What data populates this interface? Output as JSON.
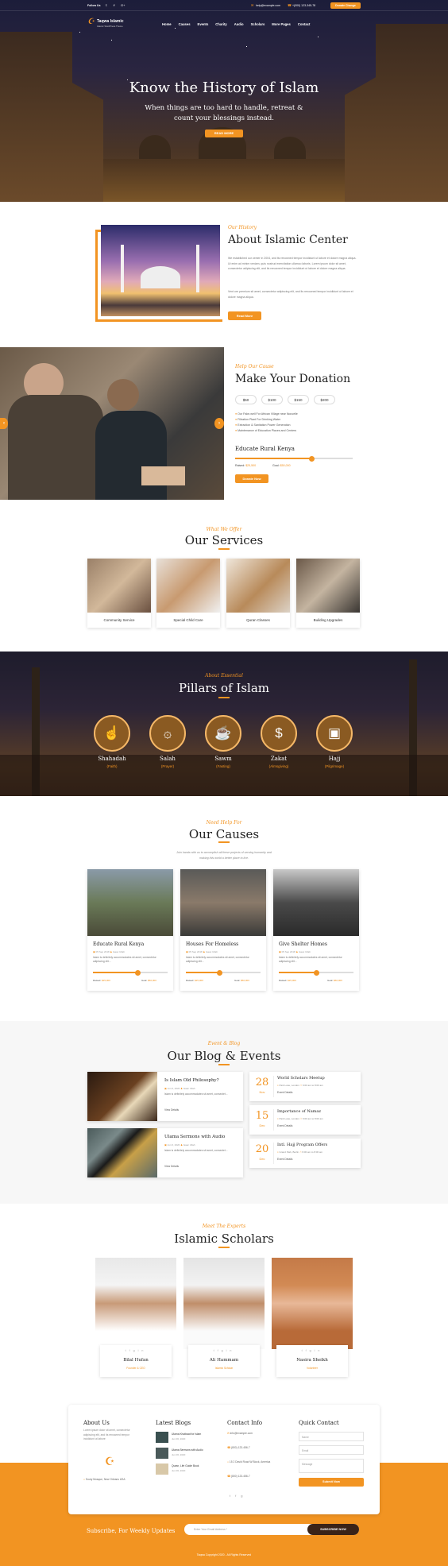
{
  "topbar": {
    "follow": "Follow Us",
    "email": "help@example.com",
    "phone": "+(000) 123-345-78",
    "donate": "Donate Change"
  },
  "logo": {
    "name": "Taqwa Islamic",
    "tagline": "Islamic WordPress Theme"
  },
  "nav": [
    "Home",
    "Causes",
    "Events",
    "Charity",
    "Audio",
    "Scholars",
    "More Pages",
    "Contact"
  ],
  "hero": {
    "title": "Know the History of Islam",
    "subtitle1": "When things are too hard to handle, retreat &",
    "subtitle2": "count your blessings instead.",
    "button": "READ MORE"
  },
  "about": {
    "kicker": "Our History",
    "title": "About Islamic Center",
    "p1": "We established our center in 2004, and its renowned tempor incididunt ut labore et dolore magna aliqua. Ut enim ad minim veniam, quis nostrud exercitation ullamco laboris. Lorem ipsum dolor sit amet, consectetur adipiscing elit, and its renowned tempor incididunt ut labore et dolore magna aliqua.",
    "p2": "Vent ore premium sit amet, consectetur adipiscing elit, and its renowned tempor incididunt ut labore et dolore magna aliqua.",
    "button": "Read More"
  },
  "donation": {
    "kicker": "Help Our Cause",
    "title": "Make Your Donation",
    "amounts": [
      "$50",
      "$100",
      "$150",
      "$200"
    ],
    "items": [
      "Our Fake-well For African Village near Nouvelle",
      "Filtration Plant For Drinking Water",
      "Extraction & Sanitation Power Generation",
      "Maintenance of Education Places and Centers"
    ],
    "cause": "Educate Rural Kenya",
    "progress": 0.65,
    "raised_label": "Raised:",
    "raised": "$25,500",
    "goal_label": "Goal:",
    "goal": "$50,000",
    "button": "Donate Now"
  },
  "services": {
    "kicker": "What We Offer",
    "title": "Our Services",
    "items": [
      "Community Service",
      "Special Child Care",
      "Quran Classes",
      "Building Upgrades"
    ]
  },
  "pillars": {
    "kicker": "About Essential",
    "title": "Pillars of Islam",
    "items": [
      {
        "name": "Shahadah",
        "sub": "(Faith)",
        "icon": "hand-pointer-icon"
      },
      {
        "name": "Salah",
        "sub": "(Prayer)",
        "icon": "prayer-icon"
      },
      {
        "name": "Sawm",
        "sub": "(Fasting)",
        "icon": "fasting-icon"
      },
      {
        "name": "Zakat",
        "sub": "(Almsgiving)",
        "icon": "money-bag-icon"
      },
      {
        "name": "Hajj",
        "sub": "(Pilgrimage)",
        "icon": "kaaba-icon"
      }
    ]
  },
  "causes": {
    "kicker": "Need Help For",
    "title": "Our Causes",
    "intro1": "Join hands with us to accomplish all these projects of serving humanity and",
    "intro2": "making this world a better place to live.",
    "items": [
      {
        "title": "Educate Rural Kenya",
        "date": "05 Sep 2018",
        "author": "Isaac Ullah",
        "text": "Islam is definitely accommodates sit amet, consectetur adipiscing elit...",
        "progress": 0.6,
        "raised": "$25,000",
        "goal": "$50,000"
      },
      {
        "title": "Houses For Homeless",
        "date": "05 Sep 2018",
        "author": "Isaac Ullah",
        "text": "Islam is definitely accommodates sit amet, consectetur adipiscing elit...",
        "progress": 0.45,
        "raised": "$25,000",
        "goal": "$50,000"
      },
      {
        "title": "Give Shelter Homes",
        "date": "05 Sep 2018",
        "author": "Isaac Ullah",
        "text": "Islam is definitely accommodates sit amet, consectetur adipiscing elit...",
        "progress": 0.5,
        "raised": "$25,000",
        "goal": "$60,000"
      }
    ],
    "raised_label": "Raised:",
    "goal_label": "Goal:"
  },
  "blog": {
    "kicker": "Event & Blog",
    "title": "Our Blog & Events",
    "posts": [
      {
        "title": "Is Islam Old Philosophy?",
        "date": "Jun 6, 2020",
        "author": "Isaac Ullah",
        "text": "Islam is definitely accommodates sit amet, consectet...",
        "more": "View Details"
      },
      {
        "title": "Ulama Sermons with Audio",
        "date": "Jun 6, 2020",
        "author": "Isaac Ullah",
        "text": "Islam is definitely accommodates sit amet, consectet...",
        "more": "View Details"
      }
    ],
    "events": [
      {
        "day": "28",
        "month": "Nov",
        "title": "World Scholars Meetup",
        "place": "Park Lane, London",
        "time": "6:00 am to 8:00 am",
        "more": "Event Details"
      },
      {
        "day": "15",
        "month": "Dec",
        "title": "Importance of Namaz",
        "place": "Park Lane, London",
        "time": "6:00 am to 8:00 am",
        "more": "Event Details"
      },
      {
        "day": "20",
        "month": "Dec",
        "title": "Intl. Hajj Program Offers",
        "place": "Grand Park, Berlin",
        "time": "6:00 am to 8:00 am",
        "more": "Event Details"
      }
    ]
  },
  "scholars": {
    "kicker": "Meet The Experts",
    "title": "Islamic Scholars",
    "items": [
      {
        "name": "Bilal Hufan",
        "role": "Founder & CEO"
      },
      {
        "name": "Ali Hammam",
        "role": "Islamic Scholar"
      },
      {
        "name": "Nasira Sheikh",
        "role": "Volunteer"
      }
    ]
  },
  "footer": {
    "about_title": "About Us",
    "about_text": "Lorem ipsum dolor sit amet, consectetur adipiscing elit, and its renowned tempor incididunt ut labore",
    "address": "Sooty Mosque, New Orleans USA",
    "blogs_title": "Latest Blogs",
    "blogs": [
      {
        "title": "Ulama Khutbaat for Islam",
        "date": "Jun 06, 2020"
      },
      {
        "title": "Ulama Sermons with Audio",
        "date": "Jun 06, 2020"
      },
      {
        "title": "Quran, Life Guide Book",
        "date": "Jun 06, 2020"
      }
    ],
    "contact_title": "Contact Info",
    "contact": [
      "info@example.com",
      "(800) 123-456-7",
      "15 2 David Road W Block, America",
      "(800) 123-456-7"
    ],
    "quick_title": "Quick Contact",
    "name_ph": "Name",
    "email_ph": "Email",
    "msg_ph": "Message",
    "submit": "Submit Now"
  },
  "subscribe": {
    "label": "Subscribe, For Weekly Updates",
    "placeholder": "Enter Your Email Address *",
    "button": "SUBSCRIBE NOW"
  },
  "copyright": "Taqwa Copyright 2020 - All Rights Reserved"
}
